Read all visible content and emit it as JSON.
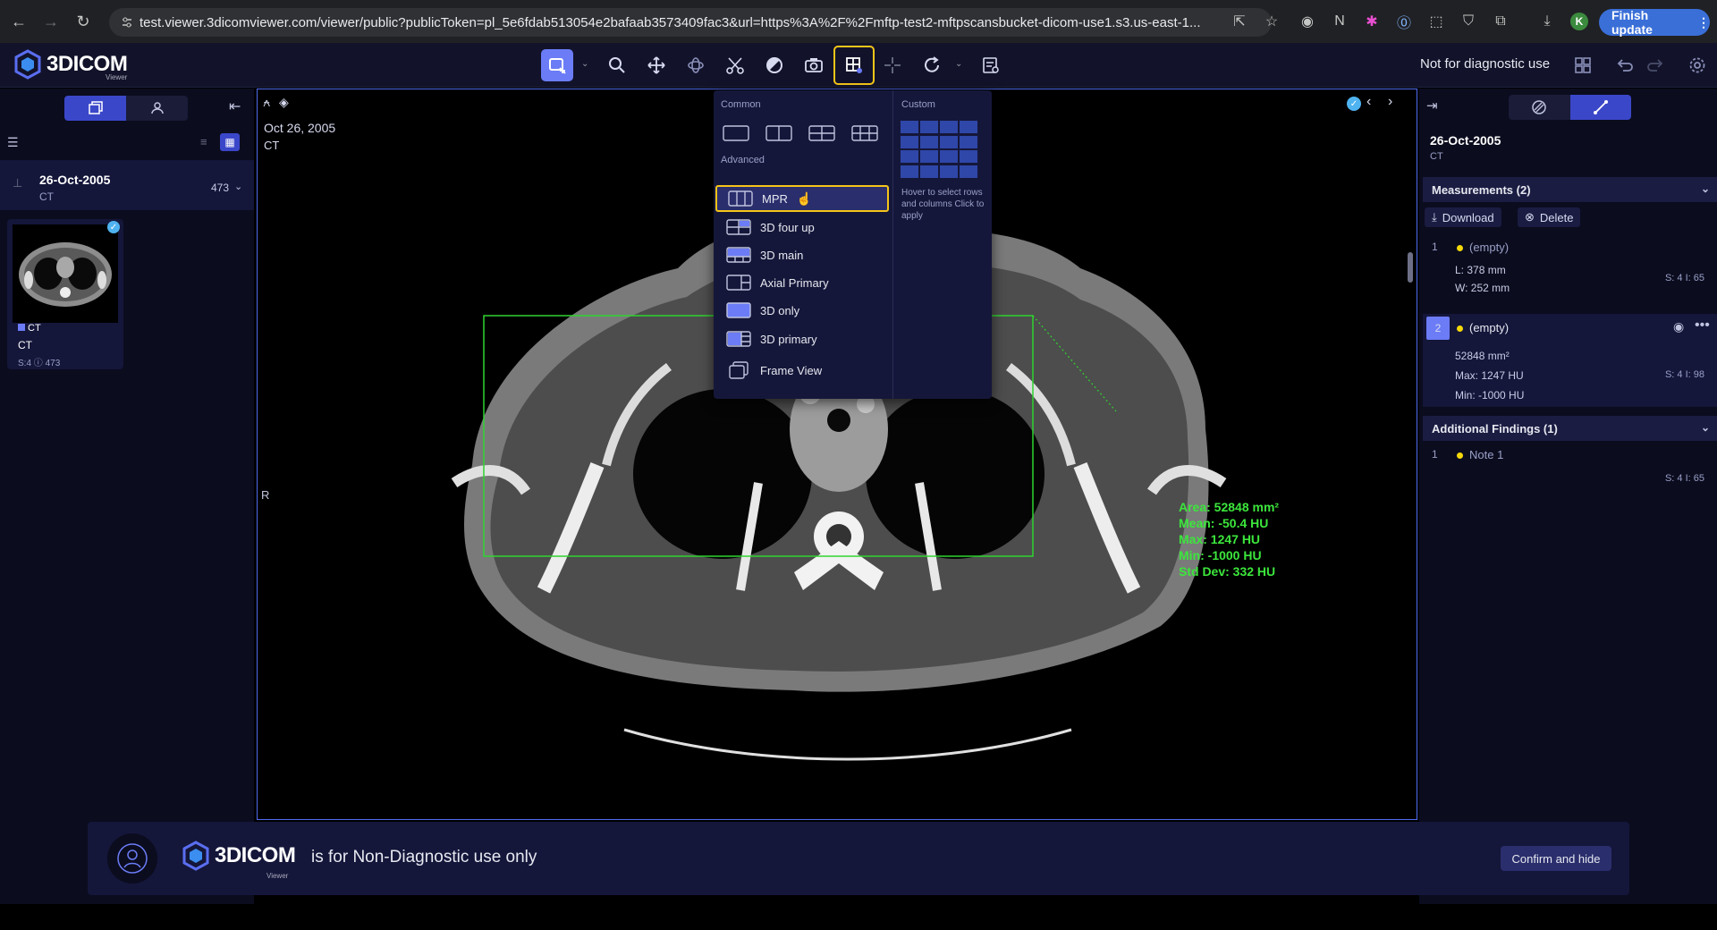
{
  "browser": {
    "url": "test.viewer.3dicomviewer.com/viewer/public?publicToken=pl_5e6fdab513054e2bafaab3573409fac3&url=https%3A%2F%2Fmftp-test2-mftpscansbucket-dicom-use1.s3.us-east-1...",
    "finish_update": "Finish update",
    "avatar_letter": "K"
  },
  "app": {
    "logo_text": "3DICOM",
    "logo_sub": "Viewer",
    "not_for_diagnostic": "Not for diagnostic use",
    "accent_color": "#6b7cf6",
    "highlight_color": "#f5c518"
  },
  "left_panel": {
    "study_date": "26-Oct-2005",
    "study_modality": "CT",
    "study_count": "473",
    "thumb_series": "CT",
    "thumb_modality": "CT",
    "thumb_meta": "S:4  ⓘ 473"
  },
  "viewport": {
    "date": "Oct 26, 2005",
    "modality": "CT",
    "orientation": "R",
    "roi_stats": [
      "Area: 52848 mm²",
      "Mean: -50.4 HU",
      "Max: 1247 HU",
      "Min: -1000 HU",
      "Std Dev: 332 HU"
    ]
  },
  "layout_menu": {
    "common_label": "Common",
    "advanced_label": "Advanced",
    "custom_label": "Custom",
    "custom_hint": "Hover to select rows and columns Click to apply",
    "items": [
      {
        "label": "MPR",
        "selected": true
      },
      {
        "label": "3D four up",
        "selected": false
      },
      {
        "label": "3D main",
        "selected": false
      },
      {
        "label": "Axial Primary",
        "selected": false
      },
      {
        "label": "3D only",
        "selected": false
      },
      {
        "label": "3D primary",
        "selected": false
      },
      {
        "label": "Frame View",
        "selected": false
      }
    ]
  },
  "right_panel": {
    "date": "26-Oct-2005",
    "modality": "CT",
    "measurements_title": "Measurements (2)",
    "download": "Download",
    "delete": "Delete",
    "measurements": [
      {
        "index": "1",
        "name": "(empty)",
        "line1": "L: 378 mm",
        "line2": "W: 252 mm",
        "line3": "",
        "slice": "S: 4 I: 65"
      },
      {
        "index": "2",
        "name": "(empty)",
        "line1": "52848 mm²",
        "line2": "Max: 1247 HU",
        "line3": "Min: -1000 HU",
        "slice": "S: 4 I: 98"
      }
    ],
    "findings_title": "Additional Findings (1)",
    "findings": [
      {
        "index": "1",
        "name": "Note 1",
        "slice": "S: 4 I: 65"
      }
    ]
  },
  "banner": {
    "logo_text": "3DICOM",
    "logo_sub": "Viewer",
    "text": "is for Non-Diagnostic use only",
    "confirm": "Confirm and hide"
  }
}
